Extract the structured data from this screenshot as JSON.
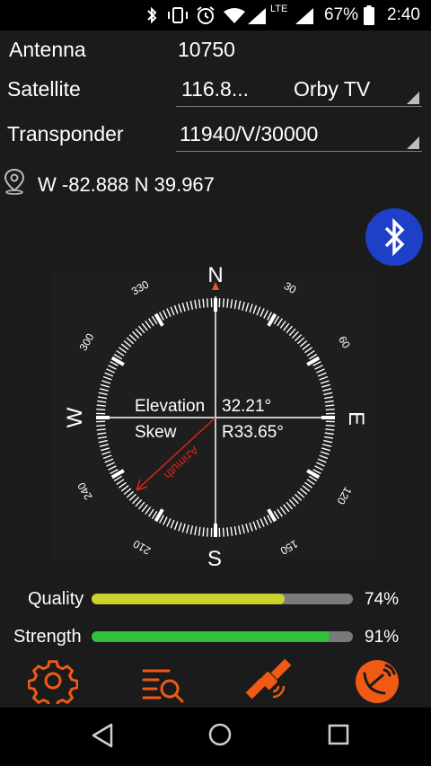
{
  "status_bar": {
    "lte_label": "LTE",
    "battery_percent": "67%",
    "time": "2:40",
    "icons": [
      "bluetooth-icon",
      "vibrate-icon",
      "alarm-icon",
      "wifi-icon",
      "cell-signal-icon",
      "battery-icon"
    ]
  },
  "antenna": {
    "label": "Antenna",
    "value": "10750"
  },
  "satellite": {
    "label": "Satellite",
    "position": "116.8...",
    "name": "Orby TV"
  },
  "transponder": {
    "label": "Transponder",
    "value": "11940/V/30000"
  },
  "location": {
    "icon": "location-pin-icon",
    "text": "W -82.888 N 39.967"
  },
  "bluetooth_button": {
    "icon": "bluetooth-icon",
    "color": "#1e40c8"
  },
  "compass": {
    "north": "N",
    "east": "E",
    "south": "S",
    "west": "W",
    "ticks": [
      "30",
      "60",
      "120",
      "150",
      "210",
      "240",
      "300",
      "330"
    ],
    "elevation_label": "Elevation",
    "elevation_value": "32.21°",
    "skew_label": "Skew",
    "skew_value": "R33.65°",
    "azimuth_label": "Azimuth",
    "azimuth_color": "#e02020"
  },
  "quality": {
    "label": "Quality",
    "percent_text": "74%",
    "level": 0.74,
    "color": "#cdd12c"
  },
  "strength": {
    "label": "Strength",
    "percent_text": "91%",
    "level": 0.91,
    "color": "#2fc23a"
  },
  "toolbar": {
    "items": [
      "settings-gear-icon",
      "search-list-icon",
      "satellite-icon",
      "dish-icon"
    ],
    "accent": "#f05a14"
  },
  "navigation": {
    "items": [
      "back-icon",
      "home-icon",
      "recents-icon"
    ]
  }
}
